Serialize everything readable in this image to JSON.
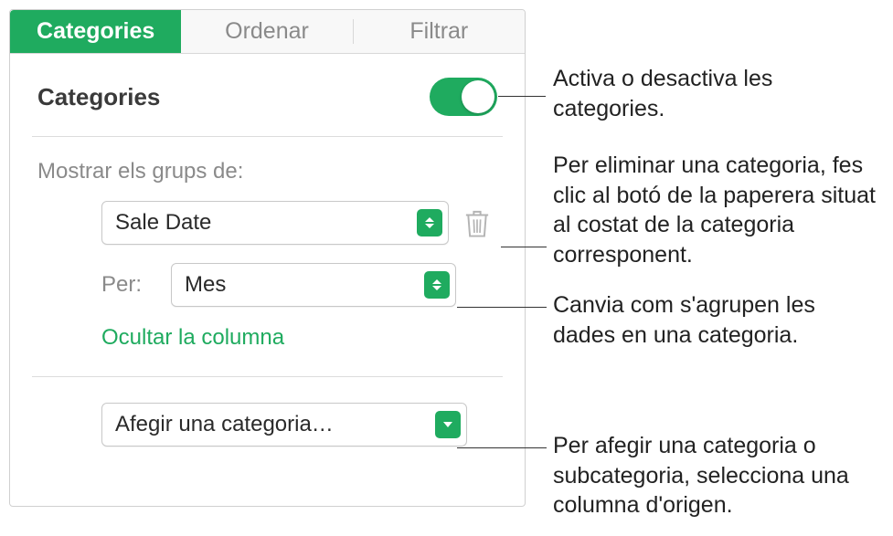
{
  "tabs": {
    "categories": "Categories",
    "sort": "Ordenar",
    "filter": "Filtrar"
  },
  "header": {
    "title": "Categories"
  },
  "groups": {
    "label": "Mostrar els grups de:",
    "column_value": "Sale Date",
    "per_label": "Per:",
    "per_value": "Mes",
    "hide_column": "Ocultar la columna"
  },
  "add": {
    "label": "Afegir una categoria…"
  },
  "annotations": {
    "toggle": "Activa o desactiva les categories.",
    "trash": "Per eliminar una categoria, fes clic al botó de la paperera situat al costat de la categoria corresponent.",
    "per": "Canvia com s'agrupen les dades en una categoria.",
    "add": "Per afegir una categoria o subcategoria, selecciona una columna d'origen."
  }
}
